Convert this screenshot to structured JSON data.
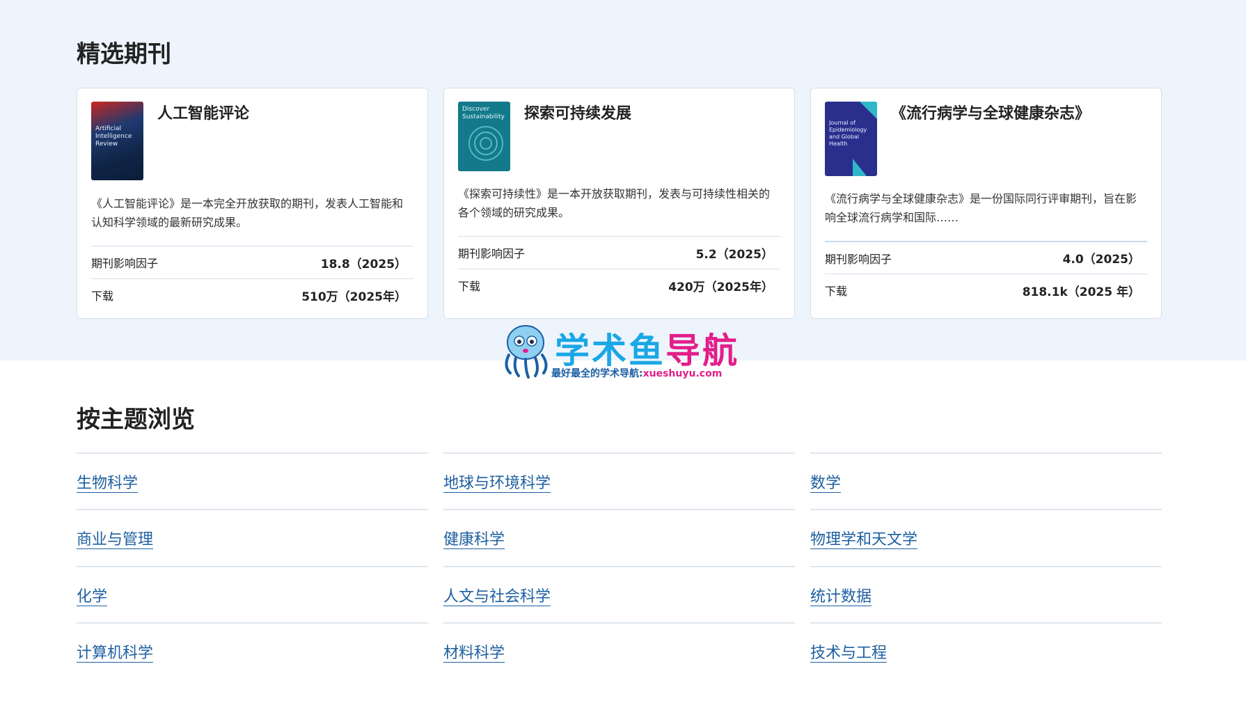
{
  "featured": {
    "title": "精选期刊",
    "cards": [
      {
        "title": "人工智能评论",
        "cover_text": "Artificial Intelligence Review",
        "description": "《人工智能评论》是一本完全开放获取的期刊，发表人工智能和认知科学领域的最新研究成果。",
        "impact_label": "期刊影响因子",
        "impact_value": "18.8（2025）",
        "download_label": "下载",
        "download_value": "510万（2025年）"
      },
      {
        "title": "探索可持续发展",
        "cover_text": "Discover Sustainability",
        "description": "《探索可持续性》是一本开放获取期刊，发表与可持续性相关的各个领域的研究成果。",
        "impact_label": "期刊影响因子",
        "impact_value": "5.2（2025）",
        "download_label": "下载",
        "download_value": "420万（2025年）"
      },
      {
        "title": "《流行病学与全球健康杂志》",
        "cover_text": "Journal of Epidemiology and Global Health",
        "description": "《流行病学与全球健康杂志》是一份国际同行评审期刊，旨在影响全球流行病学和国际……",
        "impact_label": "期刊影响因子",
        "impact_value": "4.0（2025）",
        "download_label": "下载",
        "download_value": "818.1k（2025 年）"
      }
    ]
  },
  "watermark": {
    "brand_part1": "学术鱼",
    "brand_part2": "导航",
    "subtitle": "最好最全的学术导航:",
    "url": "xueshuyu.com"
  },
  "browse": {
    "title": "按主题浏览",
    "topics": [
      "生物科学",
      "地球与环境科学",
      "数学",
      "商业与管理",
      "健康科学",
      "物理学和天文学",
      "化学",
      "人文与社会科学",
      "统计数据",
      "计算机科学",
      "材料科学",
      "技术与工程"
    ]
  },
  "colors": {
    "featured_bg": "#eef4fc",
    "link": "#1d5fa0",
    "brand_blue": "#1aa7e6",
    "brand_pink": "#e21e8a"
  }
}
